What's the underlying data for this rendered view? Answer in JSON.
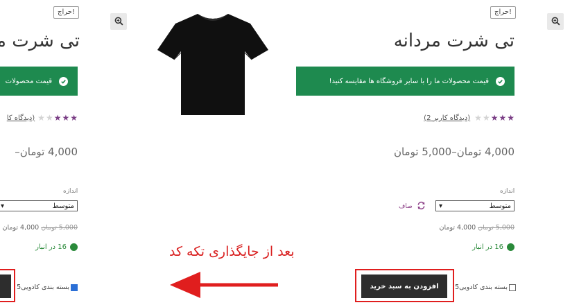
{
  "product": {
    "sale_badge": "حراج!",
    "title": "تی شرت مردانه",
    "notice": "قیمت محصولات ما را با سایر فروشگاه ها مقایسه کنید!",
    "rating": 3,
    "rating_max": 5,
    "review_link": "(دیدگاه کاربر 2)",
    "price_range": "4,000 تومان–5,000 تومان",
    "attribute_label": "اندازه",
    "size_select": "متوسط",
    "clear_label": "صاف",
    "variation_old_price": "5,000 تومان",
    "variation_new_price": "4,000 تومان",
    "stock_text": "16 در انبار",
    "gift_wrap_label": "بسته بندی کادویی5",
    "add_to_cart": "افزودن به سبد خرید"
  },
  "left_clip": {
    "title": "تی شرت مر",
    "notice": "قیمت محصولات",
    "review_link": "(دیدگاه کا",
    "price_range": "4,000 تومان–",
    "size_select": "متوسط",
    "variation_price": "5,000 تومان  4,000 تومان",
    "stock_text": "16 در انبار",
    "gift_wrap_label": "بسته بندی کادویی5",
    "gift_wrap_checked": true
  },
  "annotation": {
    "text": "بعد از جایگذاری تکه کد",
    "color": "#d91f1f"
  },
  "colors": {
    "notice_bg": "#1e8a4f",
    "star": "#7b3f86",
    "cart_bg": "#2d2d2d",
    "highlight": "#e01e1e"
  },
  "icons": {
    "zoom": "zoom-in-icon",
    "check": "check-circle-icon",
    "clear": "refresh-icon",
    "stock": "stock-dot-icon",
    "arrow": "left-arrow-icon",
    "product_image": "tshirt-icon"
  }
}
